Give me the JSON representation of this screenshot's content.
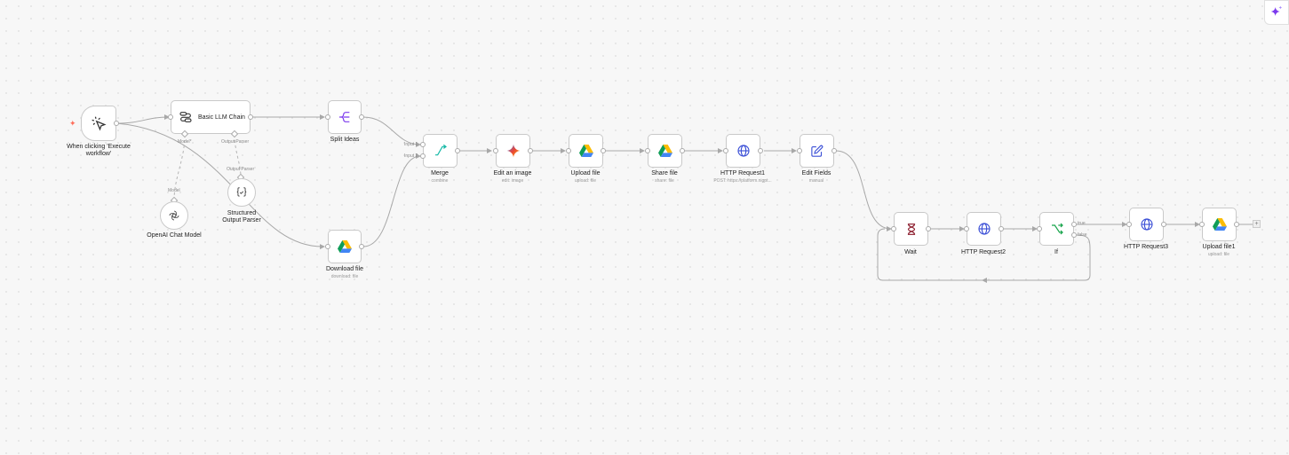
{
  "colors": {
    "accent": "#ff6d5a",
    "ai": "#7c3aed",
    "edge": "#a8a8a8"
  },
  "nodes": {
    "trigger": {
      "title": "When clicking 'Execute workflow'",
      "icon": "cursor-click-icon"
    },
    "llm_chain": {
      "title": "Basic LLM Chain",
      "port_model": "Model*",
      "port_parser": "Output Parser",
      "icon": "chain-icon"
    },
    "openai": {
      "title": "OpenAI Chat Model",
      "port": "Model",
      "icon": "openai-icon"
    },
    "parser": {
      "title": "Structured Output Parser",
      "port": "Output Parser",
      "icon": "braces-icon"
    },
    "split": {
      "title": "Split Ideas",
      "icon": "split-icon"
    },
    "download": {
      "title": "Download file",
      "sub": "download: file",
      "icon": "google-drive-icon"
    },
    "merge": {
      "title": "Merge",
      "sub": "combine",
      "in1": "Input 1",
      "in2": "Input 2",
      "icon": "merge-icon"
    },
    "edit_image": {
      "title": "Edit an image",
      "sub": "edit: image",
      "icon": "gemini-icon"
    },
    "upload": {
      "title": "Upload file",
      "sub": "upload: file",
      "icon": "google-drive-icon"
    },
    "share": {
      "title": "Share file",
      "sub": "share: file",
      "icon": "google-drive-icon"
    },
    "http1": {
      "title": "HTTP Request1",
      "sub": "POST: https://platform.nigpt...",
      "icon": "globe-icon"
    },
    "edit_fields": {
      "title": "Edit Fields",
      "sub": "manual",
      "icon": "pencil-icon"
    },
    "wait": {
      "title": "Wait",
      "icon": "hourglass-icon"
    },
    "http2": {
      "title": "HTTP Request2",
      "icon": "globe-icon"
    },
    "if": {
      "title": "If",
      "true_label": "true",
      "false_label": "false",
      "icon": "branch-icon"
    },
    "http3": {
      "title": "HTTP Request3",
      "icon": "globe-icon"
    },
    "upload1": {
      "title": "Upload file1",
      "sub": "upload: file",
      "icon": "google-drive-icon"
    }
  },
  "controls": {
    "plus": "+",
    "ai_assistant": "sparkle-icon"
  }
}
